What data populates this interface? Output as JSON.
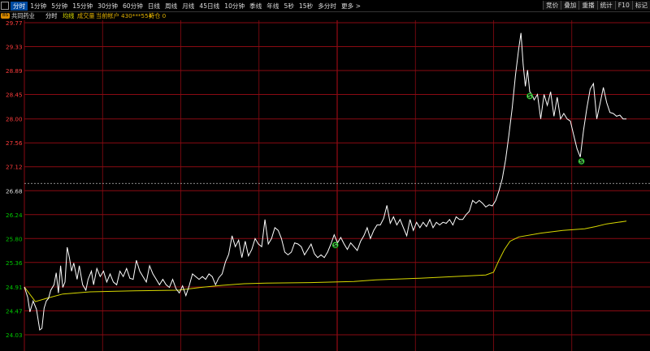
{
  "toolbar": {
    "periods": [
      "分时",
      "1分钟",
      "5分钟",
      "15分钟",
      "30分钟",
      "60分钟",
      "日线",
      "周线",
      "月线",
      "45日线",
      "10分钟",
      "季线",
      "年线",
      "5秒",
      "15秒",
      "多分时",
      "更多 >"
    ],
    "active_index": 0,
    "right_buttons": [
      "竞价",
      "叠加",
      "重播",
      "统计",
      "F10",
      "标记"
    ]
  },
  "infobar": {
    "badge": "BS",
    "stock_name": "共同药业",
    "mode": "分时",
    "avg_label": "均线",
    "volume_label": "成交量",
    "account": "当前帐户 430***554",
    "position": "持仓 0"
  },
  "colors": {
    "price_line": "#ffffff",
    "avg_line": "#d8d800",
    "grid_red": "#8a0a12",
    "label_up": "#ff3c3c",
    "label_down": "#00c800",
    "label_flat": "#dddddd",
    "signal_fill": "#5cd65c"
  },
  "chart_data": {
    "type": "line",
    "y_ticks": [
      "29.77",
      "29.33",
      "28.89",
      "28.45",
      "28.00",
      "27.56",
      "27.12",
      "26.68",
      "26.24",
      "25.80",
      "25.36",
      "24.91",
      "24.47",
      "24.03"
    ],
    "ylim": [
      24.03,
      29.77
    ],
    "prev_close": 26.68,
    "series": [
      {
        "role": "price",
        "values": [
          [
            0,
            24.91
          ],
          [
            3,
            24.72
          ],
          [
            5,
            24.45
          ],
          [
            8,
            24.65
          ],
          [
            11,
            24.5
          ],
          [
            14,
            24.12
          ],
          [
            16,
            24.15
          ],
          [
            18,
            24.52
          ],
          [
            20,
            24.65
          ],
          [
            22,
            24.7
          ],
          [
            24,
            24.85
          ],
          [
            27,
            24.95
          ],
          [
            29,
            25.17
          ],
          [
            31,
            24.8
          ],
          [
            33,
            25.3
          ],
          [
            35,
            24.9
          ],
          [
            37,
            25.0
          ],
          [
            39,
            25.64
          ],
          [
            41,
            25.45
          ],
          [
            43,
            25.2
          ],
          [
            45,
            25.35
          ],
          [
            48,
            25.05
          ],
          [
            50,
            25.3
          ],
          [
            53,
            24.95
          ],
          [
            56,
            24.85
          ],
          [
            58,
            25.05
          ],
          [
            61,
            25.2
          ],
          [
            63,
            24.95
          ],
          [
            66,
            25.25
          ],
          [
            69,
            25.1
          ],
          [
            72,
            25.2
          ],
          [
            75,
            25.0
          ],
          [
            78,
            25.15
          ],
          [
            81,
            25.0
          ],
          [
            84,
            24.95
          ],
          [
            87,
            25.2
          ],
          [
            90,
            25.1
          ],
          [
            93,
            25.25
          ],
          [
            96,
            25.07
          ],
          [
            99,
            25.05
          ],
          [
            102,
            25.4
          ],
          [
            105,
            25.2
          ],
          [
            108,
            25.1
          ],
          [
            111,
            25.0
          ],
          [
            114,
            25.3
          ],
          [
            117,
            25.15
          ],
          [
            120,
            25.05
          ],
          [
            123,
            24.95
          ],
          [
            126,
            25.05
          ],
          [
            129,
            24.95
          ],
          [
            132,
            24.9
          ],
          [
            135,
            25.05
          ],
          [
            138,
            24.88
          ],
          [
            141,
            24.8
          ],
          [
            144,
            24.93
          ],
          [
            147,
            24.75
          ],
          [
            150,
            24.93
          ],
          [
            153,
            25.15
          ],
          [
            156,
            25.1
          ],
          [
            159,
            25.05
          ],
          [
            162,
            25.1
          ],
          [
            165,
            25.05
          ],
          [
            168,
            25.15
          ],
          [
            171,
            25.1
          ],
          [
            174,
            24.95
          ],
          [
            177,
            25.08
          ],
          [
            180,
            25.15
          ],
          [
            183,
            25.37
          ],
          [
            186,
            25.51
          ],
          [
            189,
            25.85
          ],
          [
            192,
            25.65
          ],
          [
            195,
            25.77
          ],
          [
            198,
            25.45
          ],
          [
            201,
            25.75
          ],
          [
            204,
            25.48
          ],
          [
            207,
            25.6
          ],
          [
            210,
            25.8
          ],
          [
            213,
            25.7
          ],
          [
            216,
            25.65
          ],
          [
            219,
            26.15
          ],
          [
            222,
            25.7
          ],
          [
            225,
            25.8
          ],
          [
            228,
            26.0
          ],
          [
            231,
            25.95
          ],
          [
            234,
            25.8
          ],
          [
            237,
            25.55
          ],
          [
            240,
            25.5
          ],
          [
            243,
            25.55
          ],
          [
            246,
            25.72
          ],
          [
            249,
            25.7
          ],
          [
            252,
            25.65
          ],
          [
            255,
            25.5
          ],
          [
            258,
            25.6
          ],
          [
            261,
            25.7
          ],
          [
            264,
            25.52
          ],
          [
            267,
            25.45
          ],
          [
            270,
            25.5
          ],
          [
            273,
            25.45
          ],
          [
            276,
            25.55
          ],
          [
            279,
            25.7
          ],
          [
            282,
            25.87
          ],
          [
            285,
            25.72
          ],
          [
            288,
            25.82
          ],
          [
            291,
            25.7
          ],
          [
            294,
            25.6
          ],
          [
            297,
            25.72
          ],
          [
            300,
            25.65
          ],
          [
            303,
            25.58
          ],
          [
            306,
            25.75
          ],
          [
            309,
            25.85
          ],
          [
            312,
            26.0
          ],
          [
            315,
            25.8
          ],
          [
            318,
            25.95
          ],
          [
            321,
            26.05
          ],
          [
            324,
            26.05
          ],
          [
            327,
            26.17
          ],
          [
            330,
            26.41
          ],
          [
            333,
            26.08
          ],
          [
            336,
            26.2
          ],
          [
            339,
            26.05
          ],
          [
            342,
            26.15
          ],
          [
            345,
            26.0
          ],
          [
            348,
            25.85
          ],
          [
            351,
            26.15
          ],
          [
            354,
            25.95
          ],
          [
            357,
            26.1
          ],
          [
            360,
            26.0
          ],
          [
            363,
            26.1
          ],
          [
            366,
            26.02
          ],
          [
            369,
            26.15
          ],
          [
            372,
            26.0
          ],
          [
            375,
            26.1
          ],
          [
            378,
            26.05
          ],
          [
            381,
            26.1
          ],
          [
            384,
            26.08
          ],
          [
            387,
            26.15
          ],
          [
            390,
            26.05
          ],
          [
            393,
            26.2
          ],
          [
            396,
            26.15
          ],
          [
            399,
            26.15
          ],
          [
            402,
            26.24
          ],
          [
            405,
            26.3
          ],
          [
            408,
            26.5
          ],
          [
            411,
            26.45
          ],
          [
            414,
            26.5
          ],
          [
            417,
            26.45
          ],
          [
            420,
            26.38
          ],
          [
            423,
            26.42
          ],
          [
            426,
            26.4
          ],
          [
            429,
            26.5
          ],
          [
            432,
            26.68
          ],
          [
            435,
            26.9
          ],
          [
            438,
            27.25
          ],
          [
            441,
            27.7
          ],
          [
            444,
            28.2
          ],
          [
            447,
            28.8
          ],
          [
            450,
            29.3
          ],
          [
            452,
            29.58
          ],
          [
            454,
            29.0
          ],
          [
            456,
            28.6
          ],
          [
            458,
            28.9
          ],
          [
            460,
            28.5
          ],
          [
            462,
            28.45
          ],
          [
            464,
            28.35
          ],
          [
            467,
            28.45
          ],
          [
            470,
            28.0
          ],
          [
            473,
            28.45
          ],
          [
            476,
            28.25
          ],
          [
            479,
            28.5
          ],
          [
            482,
            28.05
          ],
          [
            485,
            28.4
          ],
          [
            488,
            28.0
          ],
          [
            491,
            28.1
          ],
          [
            494,
            28.0
          ],
          [
            497,
            27.96
          ],
          [
            500,
            27.7
          ],
          [
            503,
            27.45
          ],
          [
            506,
            27.3
          ],
          [
            509,
            27.8
          ],
          [
            512,
            28.2
          ],
          [
            515,
            28.55
          ],
          [
            518,
            28.65
          ],
          [
            521,
            28.0
          ],
          [
            524,
            28.28
          ],
          [
            527,
            28.58
          ],
          [
            530,
            28.3
          ],
          [
            533,
            28.12
          ],
          [
            536,
            28.1
          ],
          [
            539,
            28.05
          ],
          [
            542,
            28.07
          ],
          [
            545,
            28.0
          ],
          [
            548,
            28.0
          ]
        ]
      },
      {
        "role": "average",
        "values": [
          [
            0,
            24.91
          ],
          [
            10,
            24.64
          ],
          [
            20,
            24.7
          ],
          [
            35,
            24.78
          ],
          [
            60,
            24.82
          ],
          [
            100,
            24.84
          ],
          [
            140,
            24.85
          ],
          [
            160,
            24.9
          ],
          [
            180,
            24.94
          ],
          [
            200,
            24.97
          ],
          [
            220,
            24.98
          ],
          [
            260,
            24.99
          ],
          [
            300,
            25.01
          ],
          [
            320,
            25.04
          ],
          [
            360,
            25.07
          ],
          [
            390,
            25.1
          ],
          [
            420,
            25.13
          ],
          [
            427,
            25.18
          ],
          [
            432,
            25.4
          ],
          [
            437,
            25.6
          ],
          [
            442,
            25.75
          ],
          [
            450,
            25.83
          ],
          [
            470,
            25.9
          ],
          [
            490,
            25.95
          ],
          [
            510,
            25.98
          ],
          [
            520,
            26.02
          ],
          [
            530,
            26.07
          ],
          [
            548,
            26.12
          ]
        ]
      }
    ],
    "signals": [
      {
        "t": 283,
        "price": 25.68,
        "label": "S"
      },
      {
        "t": 460,
        "price": 28.42,
        "label": "S"
      },
      {
        "t": 507,
        "price": 27.22,
        "label": "S"
      }
    ]
  }
}
